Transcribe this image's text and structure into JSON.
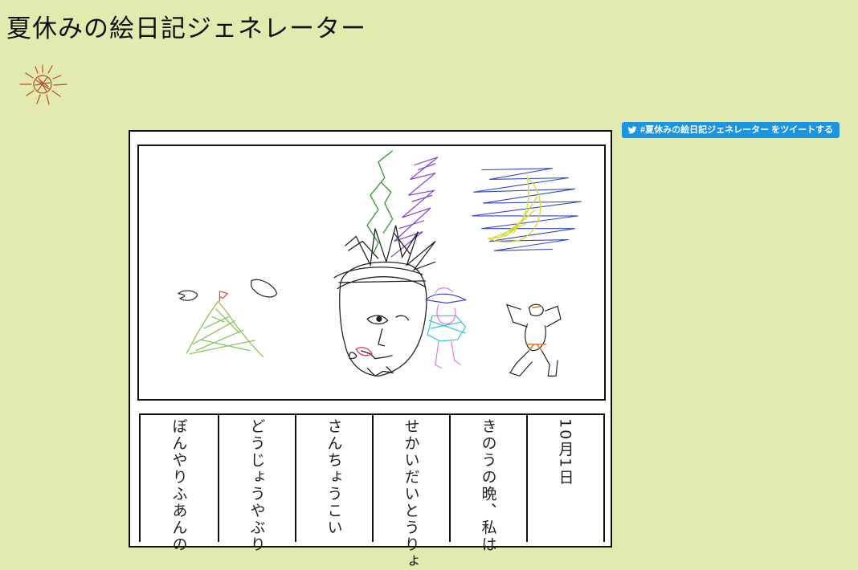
{
  "header": {
    "title": "夏休みの絵日記ジェネレーター"
  },
  "share": {
    "tweet_label": "#夏休みの絵日記ジェネレーター をツイートする",
    "color": "#1b95e0"
  },
  "diary": {
    "columns": [
      "10月1日",
      "きのうの晩、私は",
      "せかいだいとうりょ",
      "さんちょうこい",
      "どうじょうやぶり",
      "ぼんやりふあんの"
    ]
  },
  "colors": {
    "background": "#e2eab0"
  }
}
